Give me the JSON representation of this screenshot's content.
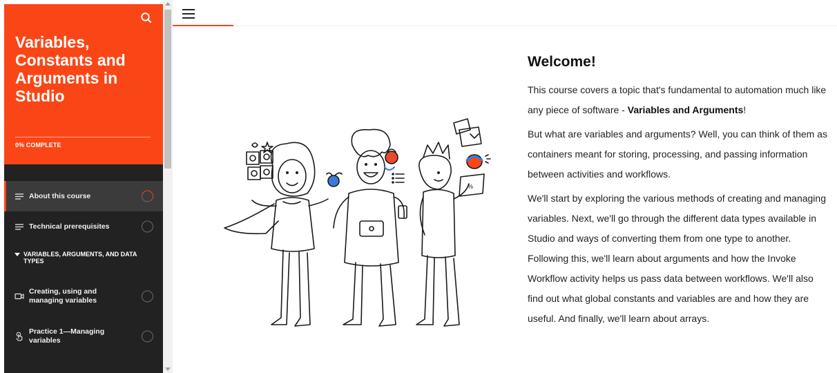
{
  "sidebar": {
    "course_title": "Variables, Constants and Arguments in Studio",
    "progress_label": "0% COMPLETE",
    "lessons": [
      {
        "label": "About this course",
        "icon": "lines-icon",
        "active": true
      },
      {
        "label": "Technical prerequisites",
        "icon": "lines-icon",
        "active": false
      }
    ],
    "section_label": "VARIABLES, ARGUMENTS, AND DATA TYPES",
    "section_lessons": [
      {
        "label": "Creating, using and managing variables",
        "icon": "video-camera-icon"
      },
      {
        "label": "Practice 1—Managing variables",
        "icon": "hand-pointer-icon"
      }
    ]
  },
  "content": {
    "heading": "Welcome!",
    "p1_before": "This course covers a topic that's fundamental to automation much like any piece of software - ",
    "p1_bold": "Variables and Arguments",
    "p1_after": "!",
    "p2": "But what are variables and arguments? Well, you can think of them as containers meant for storing, processing, and passing information between activities and workflows.",
    "p3": "We'll start by exploring the various methods of creating and managing variables. Next, we'll go through the different data types available in Studio and ways of converting them from one type to another. Following this, we'll learn about arguments and how the Invoke Workflow activity helps us pass data between workflows. We'll also find out what global constants and variables are and how they are useful. And finally, we'll learn about arrays."
  },
  "colors": {
    "brand_orange": "#fa4616",
    "sidebar_bg": "#222222",
    "active_item_bg": "#3b3b3b"
  }
}
